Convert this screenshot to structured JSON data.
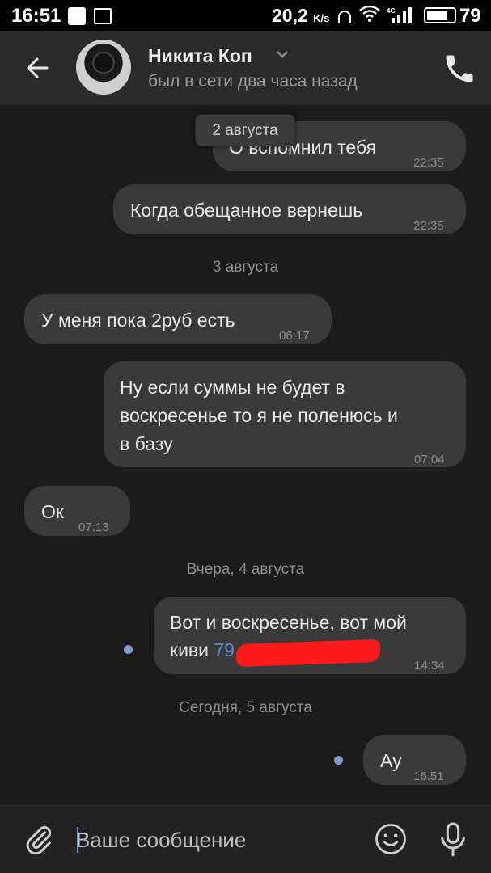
{
  "status_bar": {
    "time": "16:51",
    "speed": "20,2",
    "speed_unit": "K/s",
    "network": "4G",
    "battery": "79",
    "battery_fraction": 0.79
  },
  "header": {
    "contact_name": "Никита Коп",
    "contact_status": "был в сети два часа назад"
  },
  "sticky_date": "2 августа",
  "messages": [
    {
      "text": "О вспомнил тебя",
      "time": "22:35"
    },
    {
      "text": "Когда обещанное вернешь",
      "time": "22:35"
    },
    {
      "text": "У меня пока 2руб есть",
      "time": "06:17"
    },
    {
      "line1": "Ну если суммы не будет в",
      "line2": "воскресенье то я не поленюсь и",
      "line3": "в базу",
      "time": "07:04"
    },
    {
      "text": "Ок",
      "time": "07:13"
    },
    {
      "line1": "Вот и воскресенье, вот мой",
      "line2": "киви",
      "phone_prefix": "79",
      "time": "14:34"
    },
    {
      "text": "Ау",
      "time": "16:51"
    }
  ],
  "dates": {
    "aug3": "3 августа",
    "aug4": "Вчера, 4 августа",
    "aug5": "Сегодня, 5 августа"
  },
  "composer": {
    "placeholder": "Ваше сообщение"
  },
  "colors": {
    "accent": "#7e9ad2",
    "link": "#5e8cc7",
    "redaction": "#ff1b1b"
  }
}
